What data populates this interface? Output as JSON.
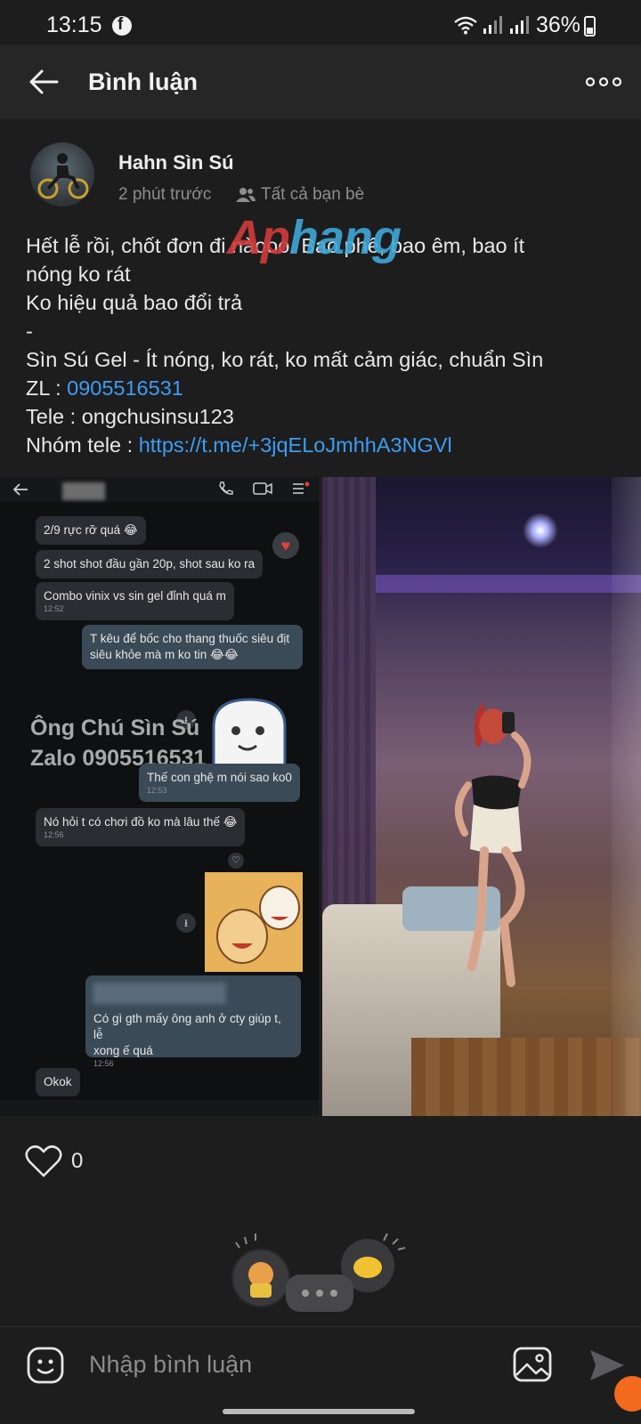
{
  "status_bar": {
    "time": "13:15",
    "battery": "36%"
  },
  "header": {
    "title": "Bình luận"
  },
  "post": {
    "author": "Hahn Sìn Sú",
    "time": "2 phút trước",
    "audience": "Tất cả bạn bè",
    "lines": {
      "l1": "Hết lễ rồi, chốt đơn đi nàooo. Bao phê, bao êm, bao ít",
      "l2": "nóng ko rát",
      "l3": "Ko hiệu quả bao đổi trả",
      "l4": "-",
      "l5": "Sìn Sú Gel - Ít nóng, ko rát, ko mất cảm giác, chuẩn Sìn",
      "l6_prefix": "ZL : ",
      "l6_link": "0905516531",
      "l7": "Tele : ongchusinsu123",
      "l8_prefix": "Nhóm tele : ",
      "l8_link": "https://t.me/+3jqELoJmhhA3NGVl"
    },
    "likes": "0"
  },
  "chat_screenshot": {
    "m1": "2/9 rực rỡ quá 😂",
    "m2": "2 shot shot đầu gần 20p, shot sau ko ra",
    "m3": "Combo vinix vs sin gel đỉnh quá m",
    "m3_time": "12:52",
    "m4a": "T kêu để bốc cho thang thuốc siêu địt",
    "m4b": "siêu khỏe mà m ko tin 😂😂",
    "watermark_1": "Ông Chú Sìn Sú",
    "watermark_2": "Zalo 0905516531",
    "m5": "Thế con ghệ m  nói sao ko0",
    "m5_time": "12:53",
    "m6": "Nó hỏi t có chơi đồ ko mà lâu thế 😂",
    "m6_time": "12:56",
    "m7a": "Có gì gth mấy ông anh ở cty giúp t, lễ",
    "m7b": "xong ế quá",
    "m7_time": "12:56",
    "m8": "Okok",
    "brand_watermark_a": "Ap",
    "brand_watermark_b": "hang"
  },
  "composer": {
    "placeholder": "Nhập bình luận"
  },
  "colors": {
    "link": "#3d9df2",
    "background": "#1d1d1e",
    "header": "#262627"
  }
}
